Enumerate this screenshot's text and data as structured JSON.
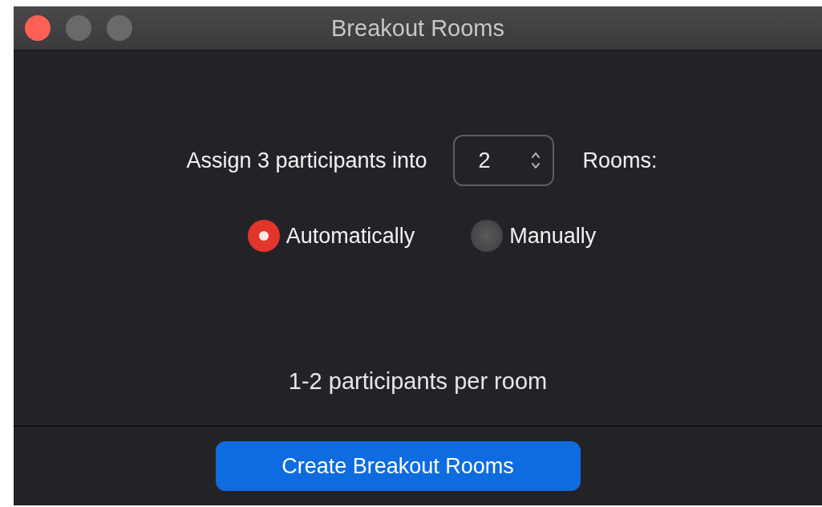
{
  "window": {
    "title": "Breakout Rooms"
  },
  "assign": {
    "prefix": "Assign 3 participants into",
    "rooms": "2",
    "suffix": "Rooms:"
  },
  "options": [
    {
      "label": "Automatically",
      "selected": true
    },
    {
      "label": "Manually",
      "selected": false
    }
  ],
  "summary": "1-2 participants per room",
  "create_button": "Create Breakout Rooms"
}
